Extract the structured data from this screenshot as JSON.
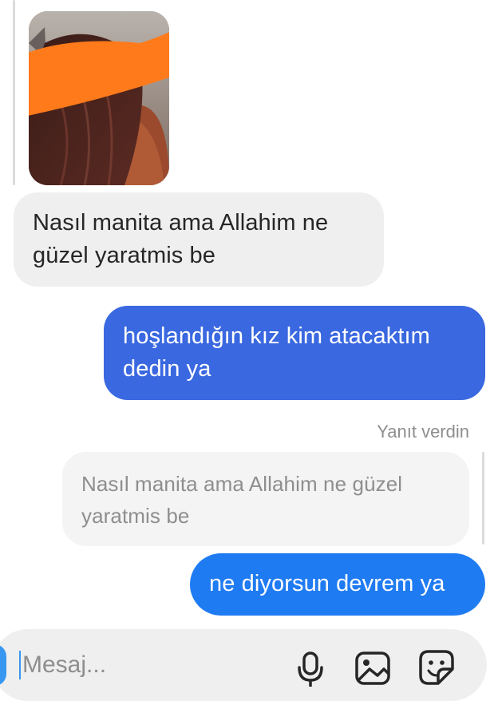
{
  "thread": {
    "photo": {
      "description_icon": "photo-icon",
      "redaction_color": "#ff7a1a"
    },
    "messages": [
      {
        "side": "received",
        "text_line1": "Nasıl manita ama Allahim ne",
        "text_line2": "güzel yaratmis be"
      },
      {
        "side": "sent",
        "text_line1": "hoşlandığın kız kim atacaktım",
        "text_line2": "dedin ya"
      }
    ],
    "reply": {
      "status": "Yanıt verdin",
      "quoted_line1": "Nasıl manita ama Allahim ne güzel",
      "quoted_line2": "yaratmis be",
      "text": "ne diyorsun devrem ya"
    }
  },
  "composer": {
    "placeholder": "Mesaj...",
    "value": "",
    "icons": [
      "camera-icon",
      "microphone-icon",
      "gallery-icon",
      "sticker-icon"
    ]
  },
  "colors": {
    "sent_bubble": "#3a68e0",
    "sent_bubble_latest": "#1f7bf2",
    "received_bubble": "#efefef",
    "accent": "#3897f0"
  }
}
